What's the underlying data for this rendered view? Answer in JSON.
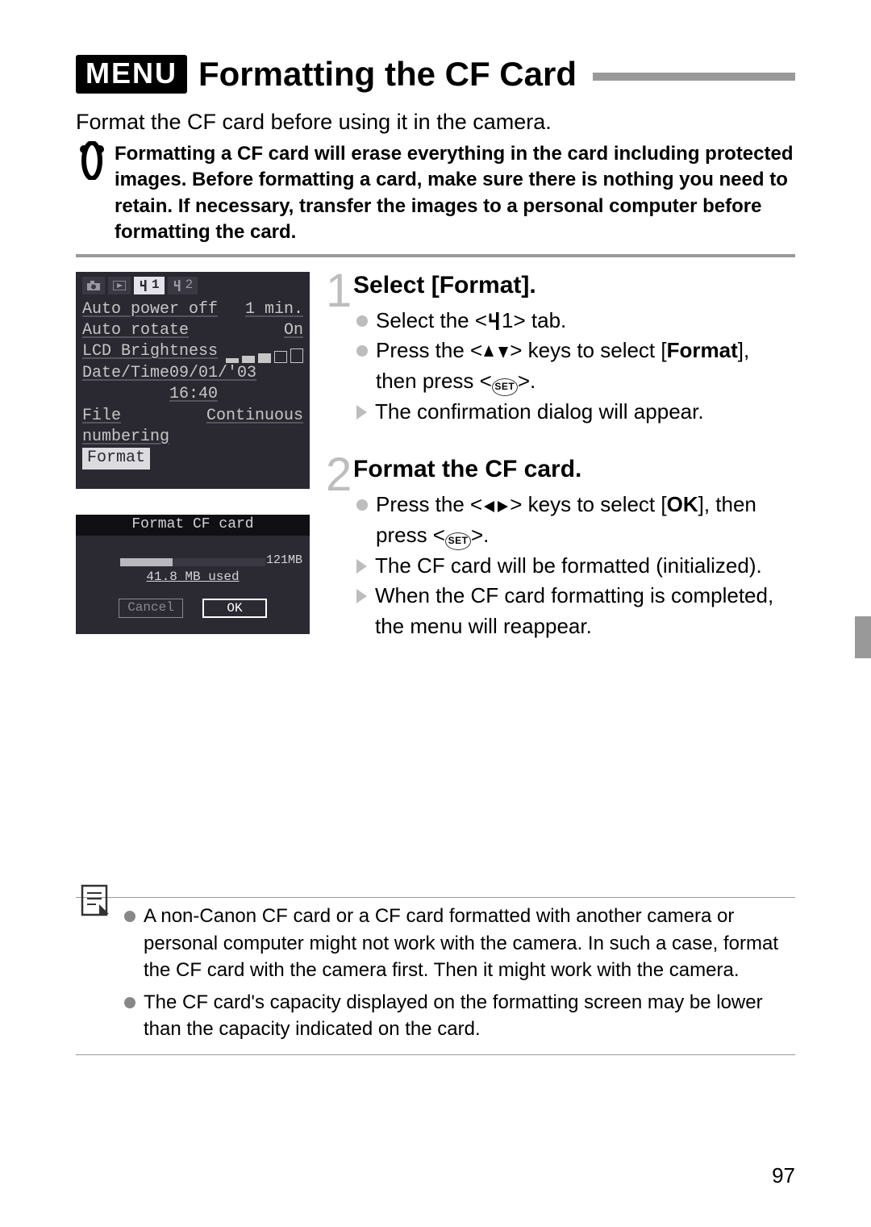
{
  "title": {
    "badge": "MENU",
    "text": "Formatting the CF Card"
  },
  "intro": "Format the CF card before using it in the camera.",
  "warning": "Formatting a CF card will erase everything in the card including protected images. Before formatting a card, make sure there is nothing you need to retain. If necessary, transfer the images to a personal computer before formatting the card.",
  "lcd_menu": {
    "tabs": {
      "t1_sel": "1",
      "t2": "2"
    },
    "rows": {
      "auto_power_off": {
        "label": "Auto power off",
        "value": "1 min."
      },
      "auto_rotate": {
        "label": "Auto rotate",
        "value": "On"
      },
      "lcd_brightness": {
        "label": "LCD Brightness"
      },
      "date_time": {
        "label": "Date/Time",
        "value": "09/01/'03 16:40"
      },
      "file_numbering": {
        "label": "File numbering",
        "value": "Continuous"
      },
      "format": {
        "label": "Format"
      }
    }
  },
  "lcd_format": {
    "title": "Format CF card",
    "capacity": "121MB",
    "used": "41.8 MB used",
    "cancel": "Cancel",
    "ok": "OK"
  },
  "steps": {
    "s1": {
      "head": "Select [Format].",
      "b1a": "Select the <",
      "b1b": "1> tab.",
      "b2a": "Press the <",
      "b2b": "> keys to select [",
      "b2c": "Format",
      "b2d": "], then press <",
      "b2e": ">.",
      "b3": "The confirmation dialog will appear."
    },
    "s2": {
      "head": "Format the CF card.",
      "b1a": "Press the <",
      "b1b": "> keys to select [",
      "b1c": "OK",
      "b1d": "], then press <",
      "b1e": ">.",
      "b2": "The CF card will be formatted (initialized).",
      "b3": "When the CF card formatting is completed, the menu will reappear."
    }
  },
  "notes": {
    "n1": "A non-Canon CF card or a CF card formatted with another camera or personal computer might not work with the camera. In such a case, format the CF card with the camera first. Then it might work with the camera.",
    "n2": "The CF card's capacity displayed on the formatting screen may be lower than the capacity indicated on the card."
  },
  "page_number": "97",
  "set_label": "SET"
}
